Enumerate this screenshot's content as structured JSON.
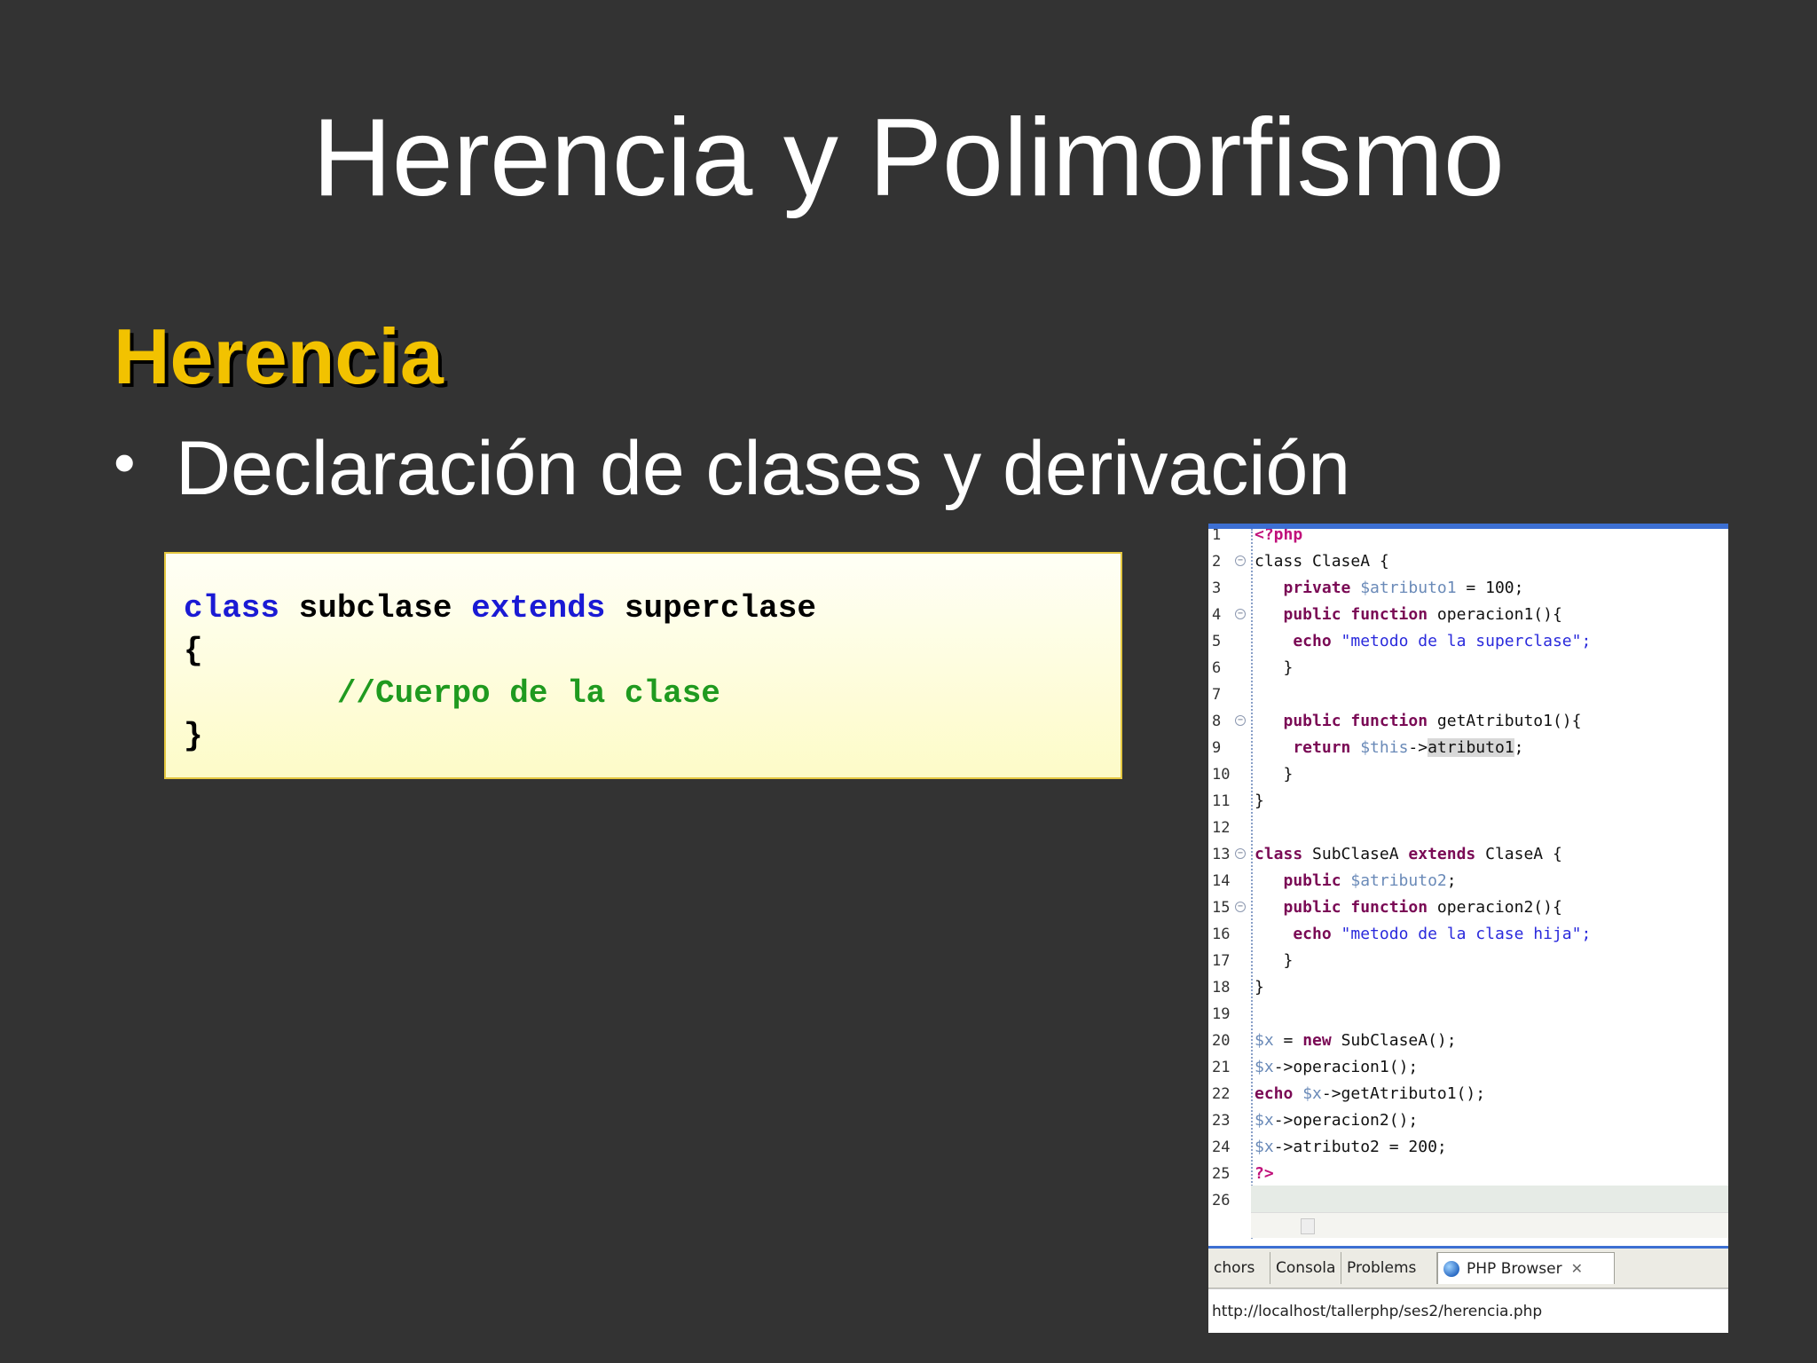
{
  "slide": {
    "title": "Herencia y Polimorfismo",
    "subtitle": "Herencia",
    "bullet": "Declaración de clases y derivación",
    "bullet_marker": "•"
  },
  "code": {
    "line1": {
      "kw1": "class",
      "name1": " subclase ",
      "kw2": "extends",
      "name2": " superclase"
    },
    "line2": "{",
    "line3_indent": "        ",
    "line3_comment": "//Cuerpo de la clase",
    "line4": "}"
  },
  "ide": {
    "lines": [
      {
        "n": "1",
        "parts": [
          [
            "ih",
            "<?php"
          ]
        ]
      },
      {
        "n": "2",
        "fold": true,
        "parts": [
          [
            "",
            "class ClaseA {"
          ]
        ]
      },
      {
        "n": "3",
        "parts": [
          [
            "ik",
            "   private "
          ],
          [
            "iv",
            "$atributo1"
          ],
          [
            "",
            " = 100;"
          ]
        ]
      },
      {
        "n": "4",
        "fold": true,
        "parts": [
          [
            "ik",
            "   public function "
          ],
          [
            "",
            "operacion1(){"
          ]
        ]
      },
      {
        "n": "5",
        "parts": [
          [
            "ik",
            "    echo "
          ],
          [
            "is",
            "\"metodo de la superclase\";"
          ]
        ]
      },
      {
        "n": "6",
        "parts": [
          [
            "",
            "   }"
          ]
        ]
      },
      {
        "n": "7",
        "parts": [
          [
            "",
            ""
          ]
        ]
      },
      {
        "n": "8",
        "fold": true,
        "parts": [
          [
            "ik",
            "   public function "
          ],
          [
            "",
            "getAtributo1(){"
          ]
        ]
      },
      {
        "n": "9",
        "parts": [
          [
            "ik",
            "    return "
          ],
          [
            "iv",
            "$this"
          ],
          [
            "",
            "->"
          ],
          [
            "sel",
            "atributo1"
          ],
          [
            "",
            ";"
          ]
        ]
      },
      {
        "n": "10",
        "parts": [
          [
            "",
            "   }"
          ]
        ]
      },
      {
        "n": "11",
        "parts": [
          [
            "",
            "}"
          ]
        ]
      },
      {
        "n": "12",
        "parts": [
          [
            "",
            ""
          ]
        ]
      },
      {
        "n": "13",
        "fold": true,
        "parts": [
          [
            "ik",
            "class "
          ],
          [
            "",
            "SubClaseA "
          ],
          [
            "ik",
            "extends "
          ],
          [
            "",
            "ClaseA {"
          ]
        ]
      },
      {
        "n": "14",
        "parts": [
          [
            "ik",
            "   public "
          ],
          [
            "iv",
            "$atributo2"
          ],
          [
            "",
            ";"
          ]
        ]
      },
      {
        "n": "15",
        "fold": true,
        "parts": [
          [
            "ik",
            "   public function "
          ],
          [
            "",
            "operacion2(){"
          ]
        ]
      },
      {
        "n": "16",
        "parts": [
          [
            "ik",
            "    echo "
          ],
          [
            "is",
            "\"metodo de la clase hija\";"
          ]
        ]
      },
      {
        "n": "17",
        "parts": [
          [
            "",
            "   }"
          ]
        ]
      },
      {
        "n": "18",
        "parts": [
          [
            "",
            "}"
          ]
        ]
      },
      {
        "n": "19",
        "parts": [
          [
            "",
            ""
          ]
        ]
      },
      {
        "n": "20",
        "parts": [
          [
            "iv",
            "$x"
          ],
          [
            "",
            " = "
          ],
          [
            "ik",
            "new "
          ],
          [
            "",
            "SubClaseA();"
          ]
        ]
      },
      {
        "n": "21",
        "parts": [
          [
            "iv",
            "$x"
          ],
          [
            "",
            "->operacion1();"
          ]
        ]
      },
      {
        "n": "22",
        "parts": [
          [
            "ik",
            "echo "
          ],
          [
            "iv",
            "$x"
          ],
          [
            "",
            "->getAtributo1();"
          ]
        ]
      },
      {
        "n": "23",
        "parts": [
          [
            "iv",
            "$x"
          ],
          [
            "",
            "->operacion2();"
          ]
        ]
      },
      {
        "n": "24",
        "parts": [
          [
            "iv",
            "$x"
          ],
          [
            "",
            "->atributo2 = 200;"
          ]
        ]
      },
      {
        "n": "25",
        "parts": [
          [
            "ih",
            "?>"
          ]
        ]
      },
      {
        "n": "26",
        "parts": [
          [
            "",
            ""
          ]
        ]
      }
    ],
    "tabs": [
      "chors",
      "Consola",
      "Problems",
      "PHP Browser"
    ],
    "url": "http://localhost/tallerphp/ses2/herencia.php"
  },
  "colors": {
    "background": "#333333",
    "subtitle": "#f2c200",
    "keyword": "#1a1ad4",
    "comment": "#1f9a1f",
    "ide_accent": "#3c6fd2"
  }
}
